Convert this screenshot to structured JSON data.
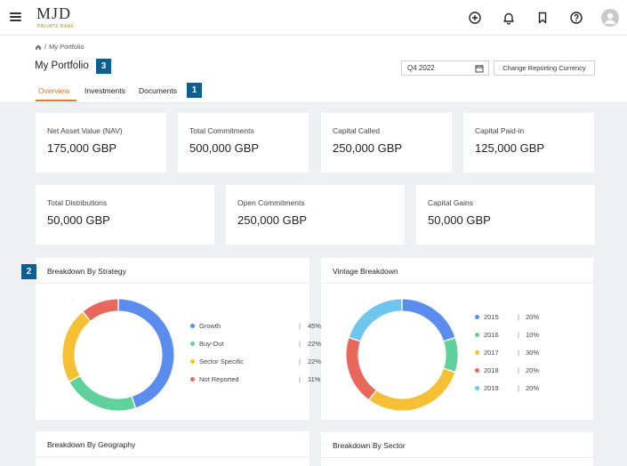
{
  "brand": {
    "name": "MJD",
    "tagline": "PRIVATE BANK"
  },
  "topbar": {
    "icons": [
      "menu-icon",
      "add-circle-icon",
      "bell-icon",
      "bookmark-icon",
      "help-icon",
      "user-avatar-icon"
    ]
  },
  "breadcrumb": {
    "separator": "/",
    "current": "My Portfolio"
  },
  "page": {
    "title": "My Portfolio"
  },
  "controls": {
    "period": "Q4 2022",
    "currency_button": "Change Reporting Currency"
  },
  "tabs": [
    {
      "label": "Overview",
      "active": true
    },
    {
      "label": "Investments",
      "active": false
    },
    {
      "label": "Documents",
      "active": false
    }
  ],
  "badges": {
    "tabs": "1",
    "strategy": "2",
    "title": "3"
  },
  "metrics_row1": [
    {
      "label": "Net Asset Value (NAV)",
      "value": "175,000 GBP"
    },
    {
      "label": "Total Commitments",
      "value": "500,000 GBP"
    },
    {
      "label": "Capital Called",
      "value": "250,000 GBP"
    },
    {
      "label": "Capital Paid-in",
      "value": "125,000 GBP"
    }
  ],
  "metrics_row2": [
    {
      "label": "Total Distributions",
      "value": "50,000 GBP"
    },
    {
      "label": "Open Commitments",
      "value": "250,000 GBP"
    },
    {
      "label": "Capital Gains",
      "value": "50,000 GBP"
    }
  ],
  "panels": {
    "strategy": "Breakdown By Strategy",
    "vintage": "Vintage Breakdown",
    "geography": "Breakdown By Geography",
    "sector": "Breakdown By Sector"
  },
  "chart_data": [
    {
      "type": "pie",
      "title": "Breakdown By Strategy",
      "categories": [
        "Growth",
        "Buy-Out",
        "Sector Specific",
        "Not Reported"
      ],
      "values": [
        45,
        22,
        22,
        11
      ],
      "labels": [
        "45%",
        "22%",
        "22%",
        "11%"
      ],
      "colors": [
        "#5b8def",
        "#5fd29b",
        "#f5c033",
        "#e8685c"
      ],
      "legend": "right"
    },
    {
      "type": "pie",
      "title": "Vintage Breakdown",
      "categories": [
        "2015",
        "2016",
        "2017",
        "2018",
        "2019"
      ],
      "values": [
        20,
        10,
        30,
        20,
        20
      ],
      "labels": [
        "20%",
        "10%",
        "30%",
        "20%",
        "20%"
      ],
      "colors": [
        "#5b8def",
        "#5fd29b",
        "#f5c033",
        "#e8685c",
        "#6ec6ef"
      ],
      "legend": "right"
    }
  ]
}
